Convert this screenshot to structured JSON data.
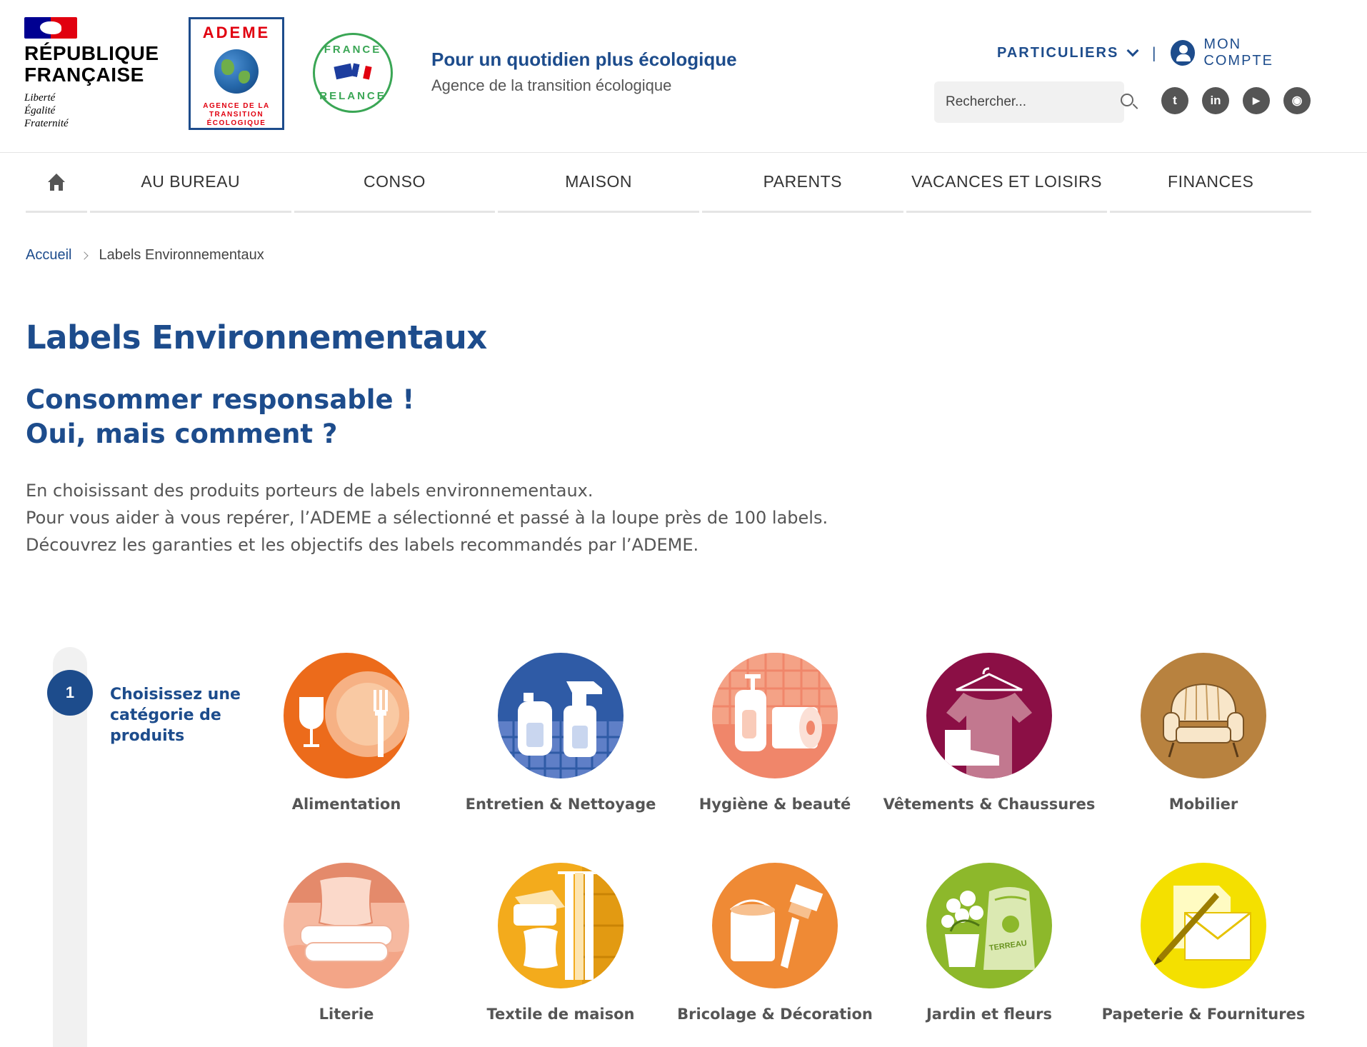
{
  "header": {
    "rf_title_line1": "RÉPUBLIQUE",
    "rf_title_line2": "FRANÇAISE",
    "rf_motto_1": "Liberté",
    "rf_motto_2": "Égalité",
    "rf_motto_3": "Fraternité",
    "ademe_name": "ADEME",
    "ademe_sub_1": "AGENCE DE LA",
    "ademe_sub_2": "TRANSITION",
    "ademe_sub_3": "ÉCOLOGIQUE",
    "relance_top": "FRANCE",
    "relance_bottom": "RELANCE",
    "tagline": "Pour un quotidien plus écologique",
    "tagline_sub": "Agence de la transition écologique",
    "audience_menu": "PARTICULIERS",
    "separator": "|",
    "account_label": "MON COMPTE",
    "search_placeholder": "Rechercher...",
    "socials": [
      {
        "name": "twitter-icon",
        "glyph": "t"
      },
      {
        "name": "linkedin-icon",
        "glyph": "in"
      },
      {
        "name": "youtube-icon",
        "glyph": "▶"
      },
      {
        "name": "rss-icon",
        "glyph": "◉"
      }
    ]
  },
  "nav": {
    "items": [
      "AU BUREAU",
      "CONSO",
      "MAISON",
      "PARENTS",
      "VACANCES ET LOISIRS",
      "FINANCES"
    ]
  },
  "breadcrumb": {
    "home": "Accueil",
    "current": "Labels Environnementaux"
  },
  "content": {
    "title": "Labels Environnementaux",
    "subtitle_line1": "Consommer responsable !",
    "subtitle_line2": "Oui, mais comment ?",
    "intro_line1": "En choisissant des produits porteurs de labels environnementaux.",
    "intro_line2": "Pour vous aider à vous repérer, l’ADEME a sélectionné et passé à la loupe près de 100 labels.",
    "intro_line3": "Découvrez les garanties et les objectifs des labels recommandés par l’ADEME."
  },
  "step": {
    "number": "1",
    "label": "Choisissez une catégorie de produits"
  },
  "categories": [
    {
      "label": "Alimentation",
      "icon": "food-icon",
      "color": "#ec6b1b"
    },
    {
      "label": "Entretien & Nettoyage",
      "icon": "cleaning-icon",
      "color": "#2f5ba6"
    },
    {
      "label": "Hygiène & beauté",
      "icon": "hygiene-icon",
      "color": "#f0866a"
    },
    {
      "label": "Vêtements & Chaussures",
      "icon": "clothing-icon",
      "color": "#8b0f45"
    },
    {
      "label": "Mobilier",
      "icon": "furniture-icon",
      "color": "#b8823f"
    },
    {
      "label": "Literie",
      "icon": "bedding-icon",
      "color": "#f2a285"
    },
    {
      "label": "Textile de maison",
      "icon": "home-textile-icon",
      "color": "#f3ab1c"
    },
    {
      "label": "Bricolage & Décoration",
      "icon": "diy-icon",
      "color": "#ef8a35"
    },
    {
      "label": "Jardin et fleurs",
      "icon": "garden-icon",
      "color": "#8db82b"
    },
    {
      "label": "Papeterie & Fournitures",
      "icon": "stationery-icon",
      "color": "#f4e000"
    }
  ]
}
